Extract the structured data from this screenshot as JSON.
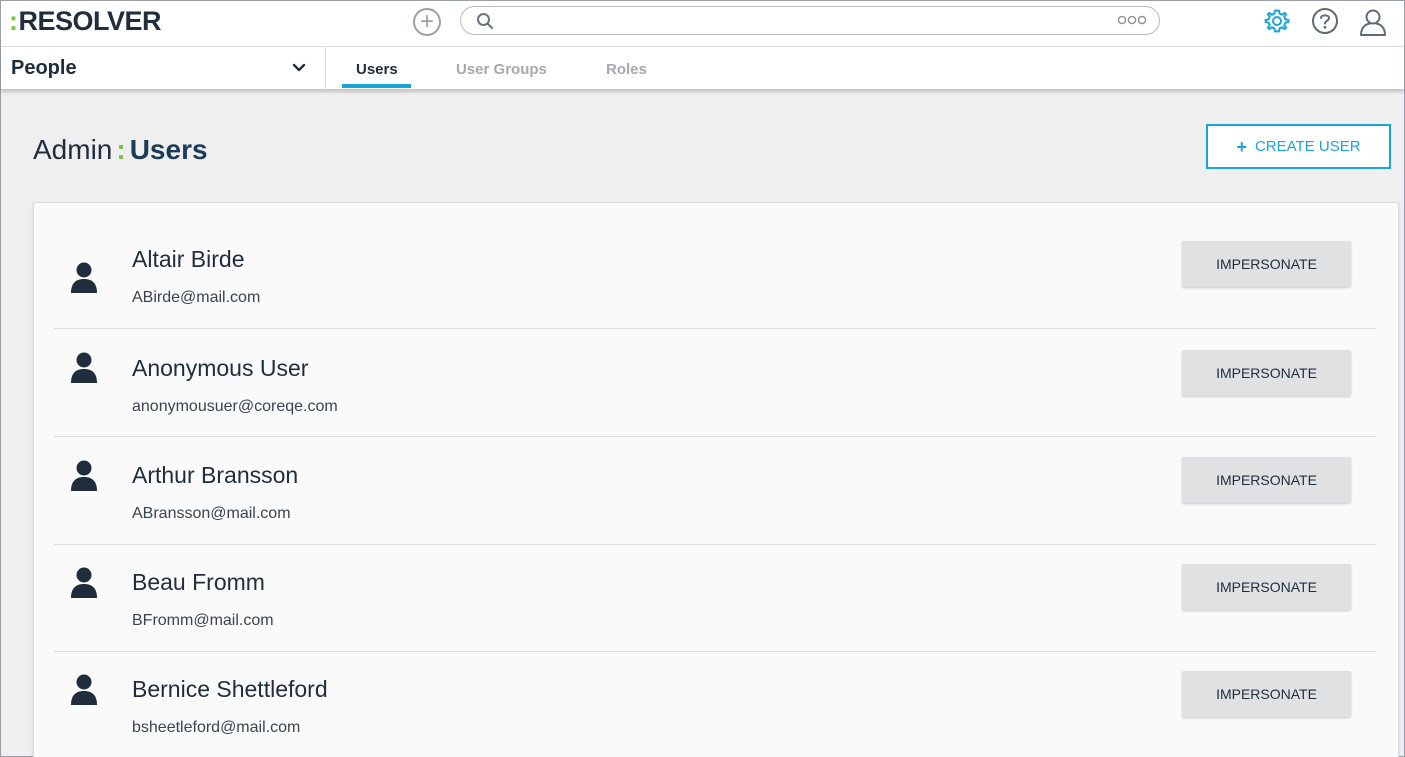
{
  "header": {
    "logo_text": "RESOLVER",
    "logo_colon": ":",
    "search": {
      "value": "",
      "placeholder": ""
    }
  },
  "subnav": {
    "section": "People",
    "tabs": [
      {
        "label": "Users",
        "active": true
      },
      {
        "label": "User Groups",
        "active": false
      },
      {
        "label": "Roles",
        "active": false
      }
    ]
  },
  "page": {
    "title_prefix": "Admin",
    "title_sep": ":",
    "title_main": "Users",
    "create_button_label": "CREATE USER",
    "create_button_icon": "+"
  },
  "users": [
    {
      "name": "Altair Birde",
      "email": "ABirde@mail.com",
      "action": "IMPERSONATE"
    },
    {
      "name": "Anonymous User",
      "email": "anonymousuer@coreqe.com",
      "action": "IMPERSONATE"
    },
    {
      "name": "Arthur Bransson",
      "email": "ABransson@mail.com",
      "action": "IMPERSONATE"
    },
    {
      "name": "Beau Fromm",
      "email": "BFromm@mail.com",
      "action": "IMPERSONATE"
    },
    {
      "name": "Bernice Shettleford",
      "email": "bsheetleford@mail.com",
      "action": "IMPERSONATE"
    }
  ],
  "colors": {
    "accent": "#1aa5d9",
    "brand_green": "#7ac143",
    "dark_text": "#1f2d3d",
    "muted_tab": "#a4a9ae"
  },
  "icons": {
    "add": "plus-circle-icon",
    "search": "search-icon",
    "more": "more-options-icon",
    "settings": "gear-icon",
    "help": "help-icon",
    "profile": "user-profile-icon",
    "user": "user-avatar-icon"
  }
}
